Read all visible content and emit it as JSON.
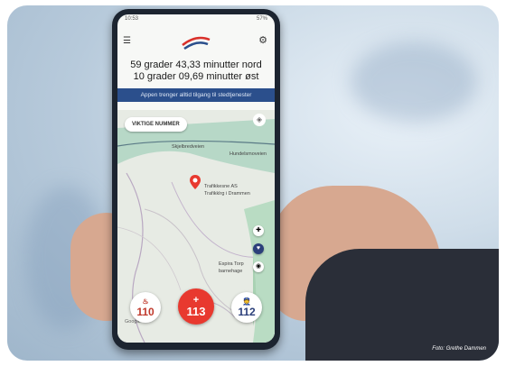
{
  "app": {
    "coords_line1": "59 grader 43,33 minutter nord",
    "coords_line2": "10 grader 09,69 minutter øst",
    "banner": "Appen trenger alltid tilgang til stedtjenester",
    "important_button": "VIKTIGE NUMMER"
  },
  "map": {
    "road_label": "Skjelbredveien",
    "road_label2": "Hundelsmoveien",
    "poi1": "Trafikkesne AS",
    "poi1_sub": "Trafikklrg i Drammen",
    "poi2": "Espira Torp",
    "poi2_sub": "barnehage",
    "google": "Google"
  },
  "emergency": {
    "fire": "110",
    "ambulance": "113",
    "police": "112"
  },
  "photo_credit": "Foto: Grethe Dammen",
  "colors": {
    "ambulance": "#e8392f",
    "police": "#2b3f7a",
    "fire": "#c0392b",
    "banner": "#2b4f8c",
    "water": "#9ec9d6"
  }
}
